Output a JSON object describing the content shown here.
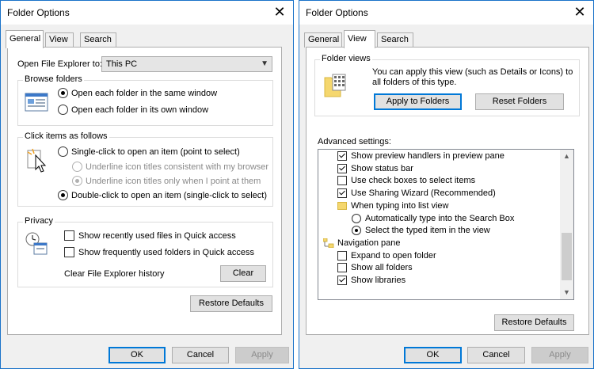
{
  "general": {
    "title": "Folder Options",
    "close_glyph": "✕",
    "tabs": [
      {
        "label": "General",
        "active": true
      },
      {
        "label": "View",
        "active": false
      },
      {
        "label": "Search",
        "active": false
      }
    ],
    "open_explorer_label": "Open File Explorer to:",
    "open_explorer_value": "This PC",
    "browse_folders": {
      "label": "Browse folders",
      "options": [
        "Open each folder in the same window",
        "Open each folder in its own window"
      ]
    },
    "click_items": {
      "label": "Click items as follows",
      "single": "Single-click to open an item (point to select)",
      "underline_browser": "Underline icon titles consistent with my browser",
      "underline_point": "Underline icon titles only when I point at them",
      "double": "Double-click to open an item (single-click to select)"
    },
    "privacy": {
      "label": "Privacy",
      "recent_files": "Show recently used files in Quick access",
      "frequent_folders": "Show frequently used folders in Quick access",
      "clear_history_label": "Clear File Explorer history",
      "clear_button": "Clear"
    },
    "restore_defaults": "Restore Defaults",
    "ok": "OK",
    "cancel": "Cancel",
    "apply": "Apply"
  },
  "view": {
    "title": "Folder Options",
    "close_glyph": "✕",
    "tabs": [
      {
        "label": "General",
        "active": false
      },
      {
        "label": "View",
        "active": true
      },
      {
        "label": "Search",
        "active": false
      }
    ],
    "folder_views": {
      "label": "Folder views",
      "description_line1": "You can apply this view (such as Details or Icons) to",
      "description_line2": "all folders of this type.",
      "apply_button": "Apply to Folders",
      "reset_button": "Reset Folders"
    },
    "advanced_label": "Advanced settings:",
    "advanced_items": [
      {
        "kind": "check",
        "checked": true,
        "label": "Show preview handlers in preview pane",
        "indent": 1
      },
      {
        "kind": "check",
        "checked": true,
        "label": "Show status bar",
        "indent": 1
      },
      {
        "kind": "check",
        "checked": false,
        "label": "Use check boxes to select items",
        "indent": 1
      },
      {
        "kind": "check",
        "checked": true,
        "label": "Use Sharing Wizard (Recommended)",
        "indent": 1
      },
      {
        "kind": "folder",
        "label": "When typing into list view",
        "indent": 1
      },
      {
        "kind": "radio",
        "checked": false,
        "label": "Automatically type into the Search Box",
        "indent": 2
      },
      {
        "kind": "radio",
        "checked": true,
        "label": "Select the typed item in the view",
        "indent": 2
      },
      {
        "kind": "nav",
        "label": "Navigation pane",
        "indent": 0
      },
      {
        "kind": "check",
        "checked": false,
        "label": "Expand to open folder",
        "indent": 1
      },
      {
        "kind": "check",
        "checked": false,
        "label": "Show all folders",
        "indent": 1
      },
      {
        "kind": "check",
        "checked": true,
        "label": "Show libraries",
        "indent": 1
      }
    ],
    "restore_defaults": "Restore Defaults",
    "ok": "OK",
    "cancel": "Cancel",
    "apply": "Apply"
  }
}
